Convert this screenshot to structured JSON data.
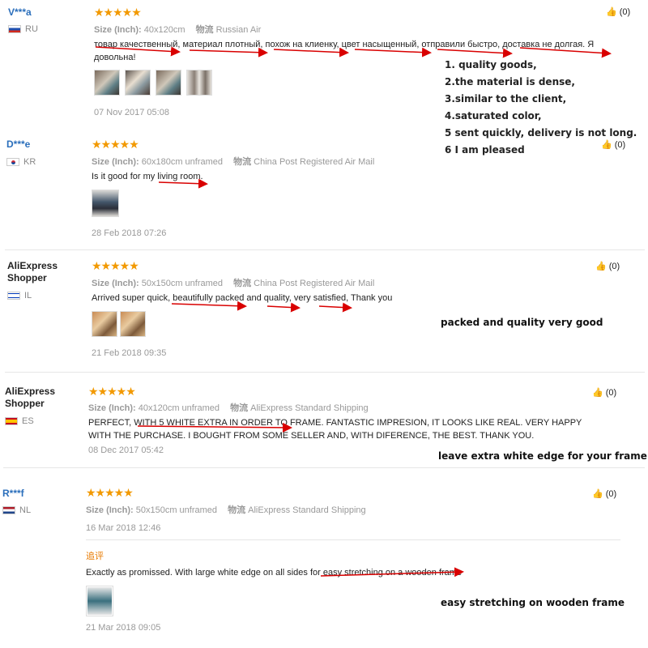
{
  "like_icon": "thumbs-up-icon",
  "arrow_color": "#d90000",
  "star_color": "#f29900",
  "reviews": [
    {
      "user": "V***a",
      "country": "RU",
      "stars": "★★★★★",
      "size_label": "Size (Inch):",
      "size_value": "40x120cm",
      "logistics_label": "物流",
      "logistics_value": "Russian Air",
      "text": "товар качественный, материал плотный, похож на клиенку, цвет насыщенный, отправили быстро, доставка не долгая. Я довольна!",
      "date": "07 Nov 2017 05:08",
      "likes": "(0)"
    },
    {
      "user": "D***e",
      "country": "KR",
      "stars": "★★★★★",
      "size_label": "Size (Inch):",
      "size_value": "60x180cm unframed",
      "logistics_label": "物流",
      "logistics_value": "China Post Registered Air Mail",
      "text": "Is it good for my living room.",
      "date": "28 Feb 2018 07:26",
      "likes": "(0)"
    },
    {
      "user": "AliExpress Shopper",
      "country": "IL",
      "stars": "★★★★★",
      "size_label": "Size (Inch):",
      "size_value": "50x150cm unframed",
      "logistics_label": "物流",
      "logistics_value": "China Post Registered Air Mail",
      "text": "Arrived super quick, beautifully packed and quality, very satisfied, Thank you",
      "date": "21 Feb 2018 09:35",
      "likes": "(0)"
    },
    {
      "user": "AliExpress Shopper",
      "country": "ES",
      "stars": "★★★★★",
      "size_label": "Size (Inch):",
      "size_value": "40x120cm unframed",
      "logistics_label": "物流",
      "logistics_value": "AliExpress Standard Shipping",
      "text": "PERFECT, WITH 5 WHITE EXTRA IN ORDER TO FRAME. FANTASTIC IMPRESION, IT LOOKS LIKE REAL. VERY HAPPY WITH THE PURCHASE. I BOUGHT FROM SOME SELLER AND, WITH DIFERENCE, THE BEST. THANK YOU.",
      "date": "08 Dec 2017 05:42",
      "likes": "(0)"
    },
    {
      "user": "R***f",
      "country": "NL",
      "stars": "★★★★★",
      "size_label": "Size (Inch):",
      "size_value": "50x150cm unframed",
      "logistics_label": "物流",
      "logistics_value": "AliExpress Standard Shipping",
      "date": "16 Mar 2018 12:46",
      "followup_label": "追评",
      "text": "Exactly as promissed. With large white edge on all sides for easy stretching on a wooden frame",
      "date2": "21 Mar 2018 09:05",
      "likes": "(0)"
    }
  ],
  "annotations": {
    "list": [
      "1. quality goods,",
      "2.the material is dense,",
      "3.similar to the client,",
      "4.saturated color,",
      "5 sent quickly, delivery is not long.",
      "6 I am pleased"
    ],
    "packed": "packed and  quality very good",
    "white_edge": "leave extra white edge for your frame",
    "stretching": "easy stretching  on  wooden frame"
  }
}
